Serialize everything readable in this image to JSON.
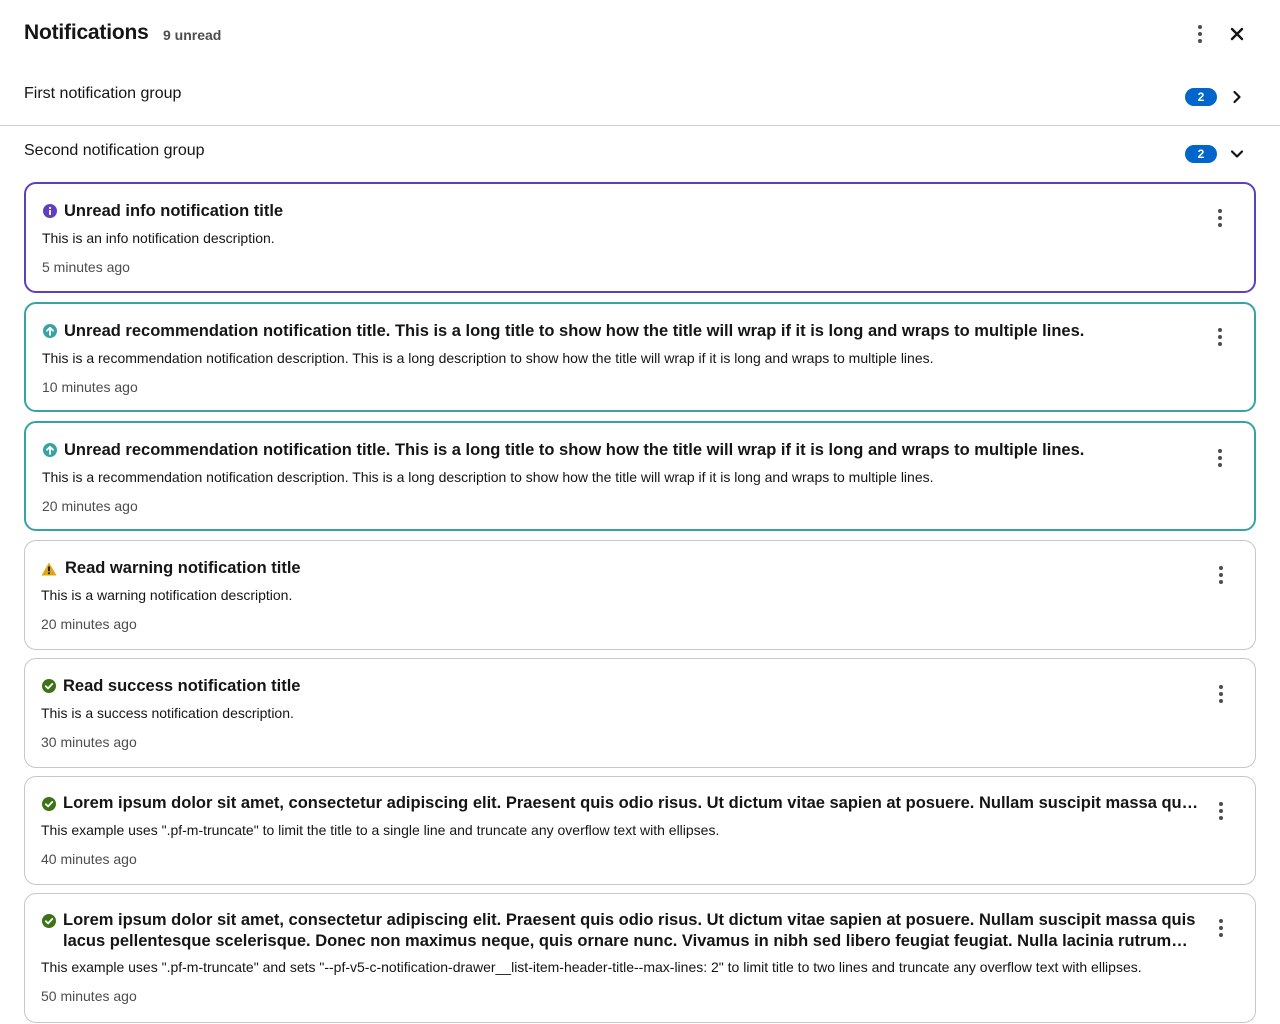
{
  "header": {
    "title": "Notifications",
    "unread_count": "9 unread"
  },
  "groups": [
    {
      "title": "First notification group",
      "count": "2",
      "expanded": false
    },
    {
      "title": "Second notification group",
      "count": "2",
      "expanded": true
    }
  ],
  "notifications": [
    {
      "variant": "info",
      "read": false,
      "title": "Unread info notification title",
      "description": "This is an info notification description.",
      "timestamp": "5 minutes ago",
      "icon": "info-circle-icon"
    },
    {
      "variant": "recommendation",
      "read": false,
      "title": "Unread recommendation notification title. This is a long title to show how the title will wrap if it is long and wraps to multiple lines.",
      "description": "This is a recommendation notification description. This is a long description to show how the title will wrap if it is long and wraps to multiple lines.",
      "timestamp": "10 minutes ago",
      "icon": "arrow-up-circle-icon"
    },
    {
      "variant": "recommendation",
      "read": false,
      "title": "Unread recommendation notification title. This is a long title to show how the title will wrap if it is long and wraps to multiple lines.",
      "description": "This is a recommendation notification description. This is a long description to show how the title will wrap if it is long and wraps to multiple lines.",
      "timestamp": "20 minutes ago",
      "icon": "arrow-up-circle-icon"
    },
    {
      "variant": "warning",
      "read": true,
      "title": "Read warning notification title",
      "description": "This is a warning notification description.",
      "timestamp": "20 minutes ago",
      "icon": "warning-triangle-icon"
    },
    {
      "variant": "success",
      "read": true,
      "title": "Read success notification title",
      "description": "This is a success notification description.",
      "timestamp": "30 minutes ago",
      "icon": "check-circle-icon"
    },
    {
      "variant": "success",
      "read": true,
      "title": "Lorem ipsum dolor sit amet, consectetur adipiscing elit. Praesent quis odio risus. Ut dictum vitae sapien at posuere. Nullam suscipit massa quis lacus pellentesque scelerisque. Donec non maximus neque, quis ornare nunc. Vivamus in nibh sed libero feugiat feugiat. Nulla lacinia rutrum est, a commodo odio rhoncus sit amet.",
      "description": "This example uses \".pf-m-truncate\" to limit the title to a single line and truncate any overflow text with ellipses.",
      "timestamp": "40 minutes ago",
      "icon": "check-circle-icon"
    },
    {
      "variant": "success",
      "read": true,
      "title": "Lorem ipsum dolor sit amet, consectetur adipiscing elit. Praesent quis odio risus. Ut dictum vitae sapien at posuere. Nullam suscipit massa quis lacus pellentesque scelerisque. Donec non maximus neque, quis ornare nunc. Vivamus in nibh sed libero feugiat feugiat. Nulla lacinia rutrum est, a commodo odio rhoncus sit amet.",
      "description": "This example uses \".pf-m-truncate\" and sets \"--pf-v5-c-notification-drawer__list-item-header-title--max-lines: 2\" to limit title to two lines and truncate any overflow text with ellipses.",
      "timestamp": "50 minutes ago",
      "icon": "check-circle-icon"
    }
  ],
  "colors": {
    "info": "#5e40be",
    "recommendation": "#37a3a3",
    "warning": "#dca614",
    "success": "#3d7317",
    "badge": "#0066cc"
  }
}
